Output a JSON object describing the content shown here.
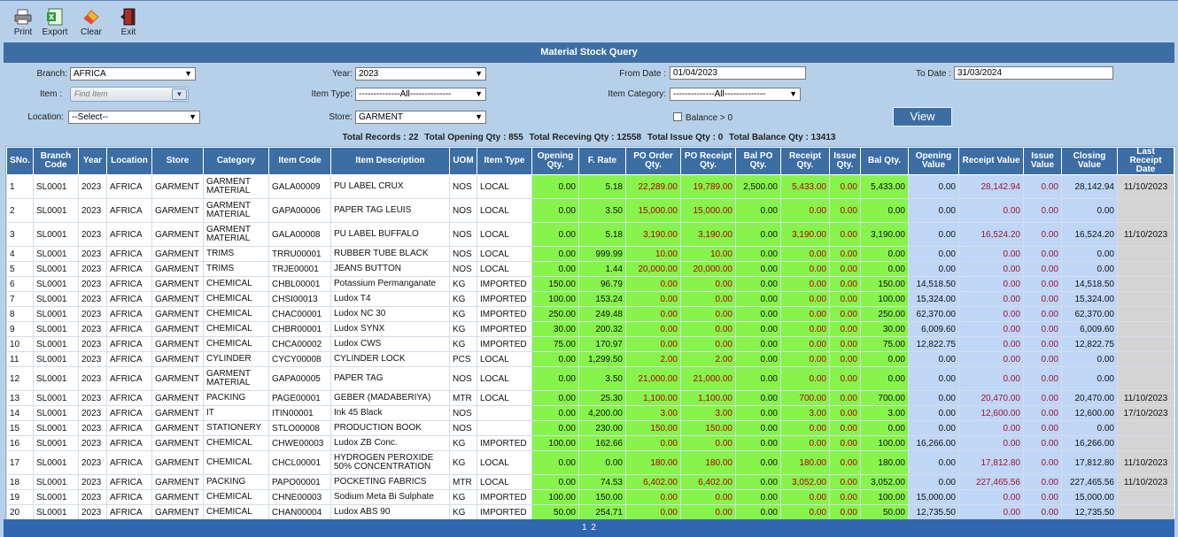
{
  "toolbar": {
    "print": "Print",
    "export": "Export",
    "clear": "Clear",
    "exit": "Exit"
  },
  "title": "Material Stock Query",
  "filters": {
    "branch_label": "Branch:",
    "branch_value": "AFRICA",
    "year_label": "Year:",
    "year_value": "2023",
    "from_date_label": "From Date :",
    "from_date_value": "01/04/2023",
    "to_date_label": "To Date :",
    "to_date_value": "31/03/2024",
    "item_label": "Item :",
    "item_placeholder": "Find Item",
    "item_type_label": "Item Type:",
    "item_type_value": "--------------All--------------",
    "item_category_label": "Item Category:",
    "item_category_value": "--------------All--------------",
    "location_label": "Location:",
    "location_value": "--Select--",
    "store_label": "Store:",
    "store_value": "GARMENT",
    "balance_label": "Balance > 0",
    "view_button": "View"
  },
  "totals": {
    "records": "Total Records : 22",
    "opening": "Total Opening Qty : 855",
    "receiving": "Total Receving Qty : 12558",
    "issue": "Total Issue Qty : 0",
    "balance": "Total Balance Qty : 13413"
  },
  "columns": [
    "SNo.",
    "Branch Code",
    "Year",
    "Location",
    "Store",
    "Category",
    "Item Code",
    "Item Description",
    "UOM",
    "Item Type",
    "Opening Qty.",
    "F. Rate",
    "PO Order Qty.",
    "PO Receipt Qty.",
    "Bal PO Qty.",
    "Receipt Qty.",
    "Issue Qty.",
    "Bal Qty.",
    "Opening Value",
    "Receipt Value",
    "Issue Value",
    "Closing Value",
    "Last Receipt Date"
  ],
  "rows": [
    [
      "1",
      "SL0001",
      "2023",
      "AFRICA",
      "GARMENT",
      "GARMENT MATERIAL",
      "GALA00009",
      "PU LABEL CRUX",
      "NOS",
      "LOCAL",
      "0.00",
      "5.18",
      "22,289.00",
      "19,789.00",
      "2,500.00",
      "5,433.00",
      "0.00",
      "5,433.00",
      "0.00",
      "28,142.94",
      "0.00",
      "28,142.94",
      "11/10/2023"
    ],
    [
      "2",
      "SL0001",
      "2023",
      "AFRICA",
      "GARMENT",
      "GARMENT MATERIAL",
      "GAPA00006",
      "PAPER TAG LEUIS",
      "NOS",
      "LOCAL",
      "0.00",
      "3.50",
      "15,000.00",
      "15,000.00",
      "0.00",
      "0.00",
      "0.00",
      "0.00",
      "0.00",
      "0.00",
      "0.00",
      "0.00",
      ""
    ],
    [
      "3",
      "SL0001",
      "2023",
      "AFRICA",
      "GARMENT",
      "GARMENT MATERIAL",
      "GALA00008",
      "PU LABEL BUFFALO",
      "NOS",
      "LOCAL",
      "0.00",
      "5.18",
      "3,190.00",
      "3,190.00",
      "0.00",
      "3,190.00",
      "0.00",
      "3,190.00",
      "0.00",
      "16,524.20",
      "0.00",
      "16,524.20",
      "11/10/2023"
    ],
    [
      "4",
      "SL0001",
      "2023",
      "AFRICA",
      "GARMENT",
      "TRIMS",
      "TRRU00001",
      "RUBBER TUBE BLACK",
      "NOS",
      "LOCAL",
      "0.00",
      "999.99",
      "10.00",
      "10.00",
      "0.00",
      "0.00",
      "0.00",
      "0.00",
      "0.00",
      "0.00",
      "0.00",
      "0.00",
      ""
    ],
    [
      "5",
      "SL0001",
      "2023",
      "AFRICA",
      "GARMENT",
      "TRIMS",
      "TRJE00001",
      "JEANS BUTTON",
      "NOS",
      "LOCAL",
      "0.00",
      "1.44",
      "20,000.00",
      "20,000.00",
      "0.00",
      "0.00",
      "0.00",
      "0.00",
      "0.00",
      "0.00",
      "0.00",
      "0.00",
      ""
    ],
    [
      "6",
      "SL0001",
      "2023",
      "AFRICA",
      "GARMENT",
      "CHEMICAL",
      "CHBL00001",
      "Potassium Permanganate",
      "KG",
      "IMPORTED",
      "150.00",
      "96.79",
      "0.00",
      "0.00",
      "0.00",
      "0.00",
      "0.00",
      "150.00",
      "14,518.50",
      "0.00",
      "0.00",
      "14,518.50",
      ""
    ],
    [
      "7",
      "SL0001",
      "2023",
      "AFRICA",
      "GARMENT",
      "CHEMICAL",
      "CHSI00013",
      "Ludox T4",
      "KG",
      "IMPORTED",
      "100.00",
      "153.24",
      "0.00",
      "0.00",
      "0.00",
      "0.00",
      "0.00",
      "100.00",
      "15,324.00",
      "0.00",
      "0.00",
      "15,324.00",
      ""
    ],
    [
      "8",
      "SL0001",
      "2023",
      "AFRICA",
      "GARMENT",
      "CHEMICAL",
      "CHAC00001",
      "Ludox NC 30",
      "KG",
      "IMPORTED",
      "250.00",
      "249.48",
      "0.00",
      "0.00",
      "0.00",
      "0.00",
      "0.00",
      "250.00",
      "62,370.00",
      "0.00",
      "0.00",
      "62,370.00",
      ""
    ],
    [
      "9",
      "SL0001",
      "2023",
      "AFRICA",
      "GARMENT",
      "CHEMICAL",
      "CHBR00001",
      "Ludox SYNX",
      "KG",
      "IMPORTED",
      "30.00",
      "200.32",
      "0.00",
      "0.00",
      "0.00",
      "0.00",
      "0.00",
      "30.00",
      "6,009.60",
      "0.00",
      "0.00",
      "6,009.60",
      ""
    ],
    [
      "10",
      "SL0001",
      "2023",
      "AFRICA",
      "GARMENT",
      "CHEMICAL",
      "CHCA00002",
      "Ludox CWS",
      "KG",
      "IMPORTED",
      "75.00",
      "170.97",
      "0.00",
      "0.00",
      "0.00",
      "0.00",
      "0.00",
      "75.00",
      "12,822.75",
      "0.00",
      "0.00",
      "12,822.75",
      ""
    ],
    [
      "11",
      "SL0001",
      "2023",
      "AFRICA",
      "GARMENT",
      "CYLINDER",
      "CYCY00008",
      "CYLINDER LOCK",
      "PCS",
      "LOCAL",
      "0.00",
      "1,299.50",
      "2.00",
      "2.00",
      "0.00",
      "0.00",
      "0.00",
      "0.00",
      "0.00",
      "0.00",
      "0.00",
      "0.00",
      ""
    ],
    [
      "12",
      "SL0001",
      "2023",
      "AFRICA",
      "GARMENT",
      "GARMENT MATERIAL",
      "GAPA00005",
      "PAPER TAG",
      "NOS",
      "LOCAL",
      "0.00",
      "3.50",
      "21,000.00",
      "21,000.00",
      "0.00",
      "0.00",
      "0.00",
      "0.00",
      "0.00",
      "0.00",
      "0.00",
      "0.00",
      ""
    ],
    [
      "13",
      "SL0001",
      "2023",
      "AFRICA",
      "GARMENT",
      "PACKING",
      "PAGE00001",
      "GEBER (MADABERIYA)",
      "MTR",
      "LOCAL",
      "0.00",
      "25.30",
      "1,100.00",
      "1,100.00",
      "0.00",
      "700.00",
      "0.00",
      "700.00",
      "0.00",
      "20,470.00",
      "0.00",
      "20,470.00",
      "11/10/2023"
    ],
    [
      "14",
      "SL0001",
      "2023",
      "AFRICA",
      "GARMENT",
      "IT",
      "ITIN00001",
      "Ink 45 Black",
      "NOS",
      "",
      "0.00",
      "4,200.00",
      "3.00",
      "3.00",
      "0.00",
      "3.00",
      "0.00",
      "3.00",
      "0.00",
      "12,600.00",
      "0.00",
      "12,600.00",
      "17/10/2023"
    ],
    [
      "15",
      "SL0001",
      "2023",
      "AFRICA",
      "GARMENT",
      "STATIONERY",
      "STLO00008",
      "PRODUCTION BOOK",
      "NOS",
      "",
      "0.00",
      "230.00",
      "150.00",
      "150.00",
      "0.00",
      "0.00",
      "0.00",
      "0.00",
      "0.00",
      "0.00",
      "0.00",
      "0.00",
      ""
    ],
    [
      "16",
      "SL0001",
      "2023",
      "AFRICA",
      "GARMENT",
      "CHEMICAL",
      "CHWE00003",
      "Ludox ZB Conc.",
      "KG",
      "IMPORTED",
      "100.00",
      "162.66",
      "0.00",
      "0.00",
      "0.00",
      "0.00",
      "0.00",
      "100.00",
      "16,266.00",
      "0.00",
      "0.00",
      "16,266.00",
      ""
    ],
    [
      "17",
      "SL0001",
      "2023",
      "AFRICA",
      "GARMENT",
      "CHEMICAL",
      "CHCL00001",
      "HYDROGEN PEROXIDE 50% CONCENTRATION",
      "KG",
      "LOCAL",
      "0.00",
      "0.00",
      "180.00",
      "180.00",
      "0.00",
      "180.00",
      "0.00",
      "180.00",
      "0.00",
      "17,812.80",
      "0.00",
      "17,812.80",
      "11/10/2023"
    ],
    [
      "18",
      "SL0001",
      "2023",
      "AFRICA",
      "GARMENT",
      "PACKING",
      "PAPO00001",
      "POCKETING FABRICS",
      "MTR",
      "LOCAL",
      "0.00",
      "74.53",
      "6,402.00",
      "6,402.00",
      "0.00",
      "3,052.00",
      "0.00",
      "3,052.00",
      "0.00",
      "227,465.56",
      "0.00",
      "227,465.56",
      "11/10/2023"
    ],
    [
      "19",
      "SL0001",
      "2023",
      "AFRICA",
      "GARMENT",
      "CHEMICAL",
      "CHNE00003",
      "Sodium Meta Bi Sulphate",
      "KG",
      "IMPORTED",
      "100.00",
      "150.00",
      "0.00",
      "0.00",
      "0.00",
      "0.00",
      "0.00",
      "100.00",
      "15,000.00",
      "0.00",
      "0.00",
      "15,000.00",
      ""
    ],
    [
      "20",
      "SL0001",
      "2023",
      "AFRICA",
      "GARMENT",
      "CHEMICAL",
      "CHAN00004",
      "Ludox ABS 90",
      "KG",
      "IMPORTED",
      "50.00",
      "254.71",
      "0.00",
      "0.00",
      "0.00",
      "0.00",
      "0.00",
      "50.00",
      "12,735.50",
      "0.00",
      "0.00",
      "12,735.50",
      ""
    ]
  ],
  "pager": [
    "1",
    "2"
  ]
}
